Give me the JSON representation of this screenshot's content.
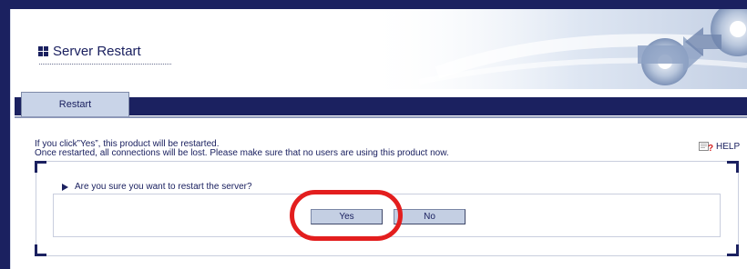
{
  "header": {
    "title": "Server Restart",
    "title_icon": "grid-icon"
  },
  "tabs": [
    {
      "label": "Restart",
      "active": true
    }
  ],
  "info": {
    "line1": "If you click”Yes”, this product will be restarted.",
    "line2": "Once restarted, all connections will be lost. Please make sure that no users are using this product now."
  },
  "help": {
    "label": "HELP",
    "icon": "help-book-icon"
  },
  "dialog": {
    "question": "Are you sure you want to restart the server?",
    "yes_label": "Yes",
    "no_label": "No"
  },
  "colors": {
    "navy": "#1b2160",
    "tab_bg": "#c9d4e8",
    "highlight": "#e31e1e"
  }
}
